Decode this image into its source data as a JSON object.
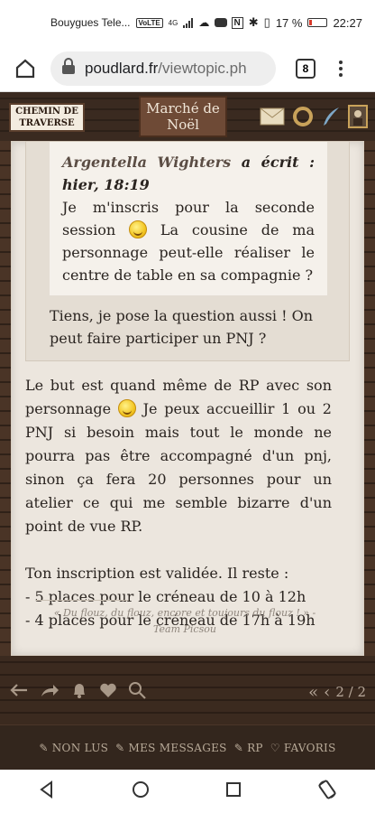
{
  "status_bar": {
    "carrier": "Bouygues Tele...",
    "volte": "VoLTE",
    "network": "4G",
    "battery": "17 %",
    "time": "22:27"
  },
  "browser": {
    "url_domain": "poudlard.fr",
    "url_path": "/viewtopic.ph",
    "tab_count": "8"
  },
  "forum_header": {
    "chemin_label": "CHEMIN DE TRAVERSE",
    "chemin_line1": "CHEMIN DE",
    "chemin_line2": "TRAVERSE",
    "marche_line1": "Marché de",
    "marche_line2": "Noël"
  },
  "quote": {
    "author": "Argentella Wighters",
    "wrote": " a écrit : hier, 18:19",
    "text_before_emoji": "Je m'inscris pour la seconde session ",
    "text_after_emoji": " La cousine de ma personnage peut-elle réaliser le centre de table en sa compagnie ?",
    "reply_text": "Tiens, je pose la question aussi ! On peut faire participer un PNJ ?"
  },
  "post": {
    "para1_before_emoji": "Le but est quand même de RP avec son personnage ",
    "para1_after_emoji": " Je peux accueillir 1 ou 2 PNJ si besoin mais tout le monde ne pourra pas être accompagné d'un pnj, sinon ça fera 20 personnes pour un atelier ce qui me semble bizarre d'un point de vue RP.",
    "line_validated": "Ton inscription est validée. Il reste :",
    "line_slot1": "- 5 places pour le créneau de 10 à 12h",
    "line_slot2": "- 4 places pour le créneau de 17h à 19h"
  },
  "signature": {
    "quote": "« Du flouz, du flouz, encore et toujours du flouz ! » -",
    "author": "Team Picsou"
  },
  "pager": {
    "text": "2 / 2"
  },
  "forum_nav": {
    "items": [
      "NON LUS",
      "MES MESSAGES",
      "RP",
      "FAVORIS"
    ]
  },
  "icons": [
    "home-icon",
    "lock-icon",
    "tabs-icon",
    "more-icon",
    "envelope-icon",
    "ring-icon",
    "quill-icon",
    "portrait-icon",
    "back-arrow-icon",
    "share-icon",
    "bell-icon",
    "heart-icon",
    "search-icon",
    "chevron-left-icon",
    "back-icon",
    "home-circle-icon",
    "recents-icon",
    "rotate-icon"
  ]
}
